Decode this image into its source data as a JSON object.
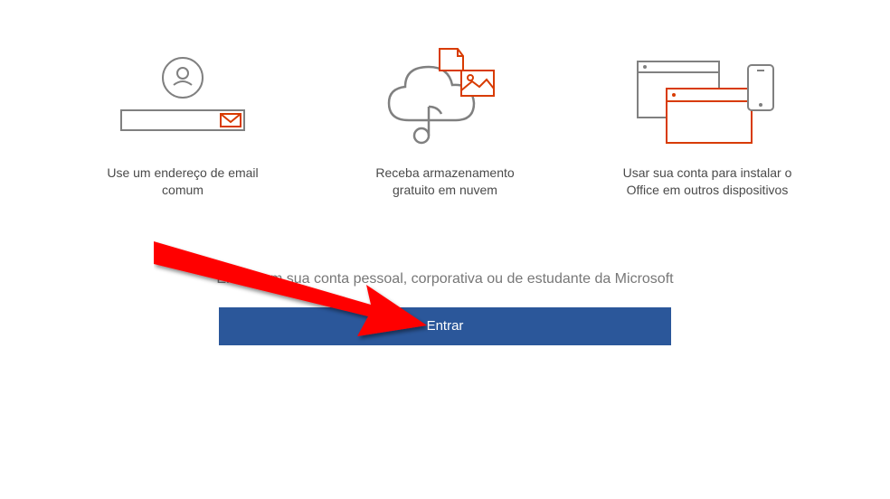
{
  "features": [
    {
      "label": "Use um endereço de email comum"
    },
    {
      "label": "Receba armazenamento gratuito em nuvem"
    },
    {
      "label": "Usar sua conta para instalar o Office em outros dispositivos"
    }
  ],
  "signin": {
    "instruction": "Entre com sua conta pessoal, corporativa ou de estudante da Microsoft",
    "button_label": "Entrar"
  },
  "colors": {
    "accent": "#2b579a",
    "icon_red": "#d83b01",
    "icon_gray": "#808080",
    "arrow": "#ff0000"
  }
}
